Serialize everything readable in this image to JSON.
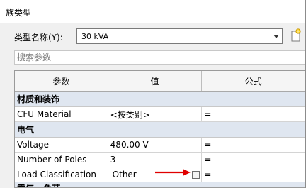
{
  "window": {
    "title": "族类型"
  },
  "type_name": {
    "label": "类型名称(Y):",
    "value": "30 kVA"
  },
  "search": {
    "placeholder": "搜索参数"
  },
  "grid": {
    "headers": [
      "参数",
      "值",
      "公式"
    ],
    "groups": [
      {
        "name": "材质和装饰",
        "rows": [
          {
            "param": "CFU Material",
            "value": "<按类别>",
            "formula": "="
          }
        ]
      },
      {
        "name": "电气",
        "rows": [
          {
            "param": "Voltage",
            "value": "480.00 V",
            "formula": "="
          },
          {
            "param": "Number of Poles",
            "value": "3",
            "formula": "="
          },
          {
            "param": "Load Classification",
            "value": "Other",
            "formula": "="
          }
        ]
      }
    ],
    "partial_group": "電気 - 負荷"
  },
  "icons": {
    "dropdown": "chevron-down-icon",
    "new_type": "new-type-icon",
    "browse": "ellipsis-icon",
    "annotation": "red-arrow-icon"
  },
  "colors": {
    "group_bg": "#dfe6f0",
    "annotation": "#e00000"
  }
}
